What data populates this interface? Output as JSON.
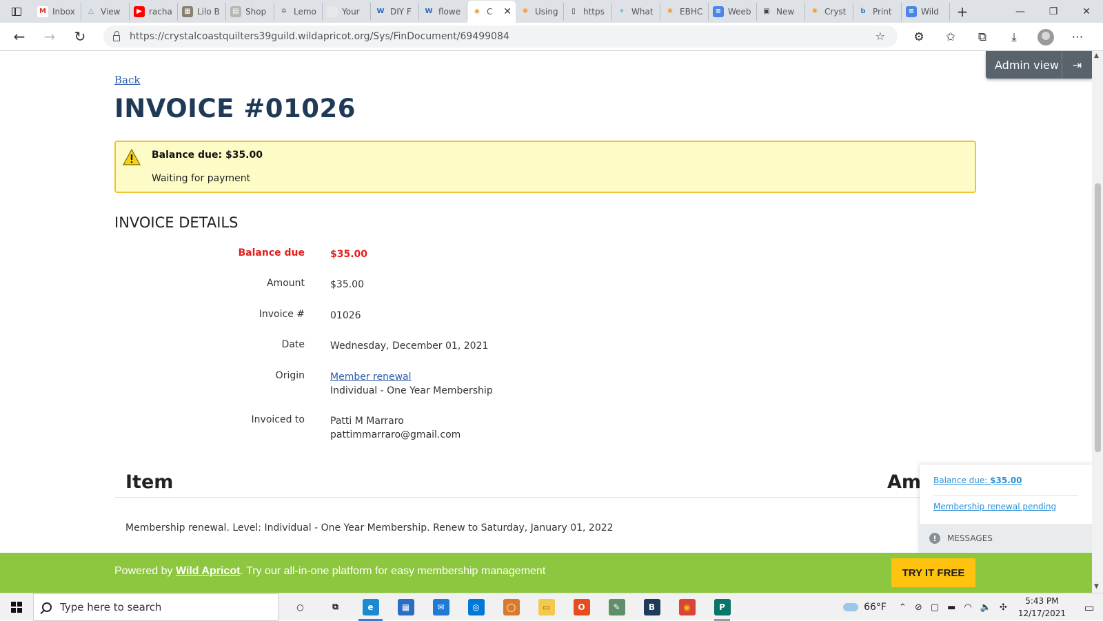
{
  "browser": {
    "tabs": [
      {
        "title": "Inbox",
        "fav_color": "#ffffff",
        "fav_glyph": "M",
        "fav_text_color": "#d93025"
      },
      {
        "title": "View",
        "fav_color": "#dee1e6",
        "fav_glyph": "△",
        "fav_text_color": "#6a8ec4"
      },
      {
        "title": "racha",
        "fav_color": "#ff0000",
        "fav_glyph": "▶",
        "fav_text_color": "#ffffff"
      },
      {
        "title": "Lilo B",
        "fav_color": "#8a7f70",
        "fav_glyph": "▦",
        "fav_text_color": "#ffffff"
      },
      {
        "title": "Shop",
        "fav_color": "#b6b6b6",
        "fav_glyph": "▤",
        "fav_text_color": "#ffffff"
      },
      {
        "title": "Lemo",
        "fav_color": "#dee1e6",
        "fav_glyph": "✲",
        "fav_text_color": "#777777"
      },
      {
        "title": "Your",
        "fav_color": "#e8e8e8",
        "fav_glyph": "",
        "fav_text_color": "#999999"
      },
      {
        "title": "DIY F",
        "fav_color": "#dee1e6",
        "fav_glyph": "W",
        "fav_text_color": "#2a6ab3"
      },
      {
        "title": "flowe",
        "fav_color": "#dee1e6",
        "fav_glyph": "W",
        "fav_text_color": "#2a6ab3"
      },
      {
        "title": "C",
        "fav_color": "#ffffff",
        "fav_glyph": "✺",
        "fav_text_color": "#f29c38",
        "active": true
      },
      {
        "title": "Using",
        "fav_color": "#dee1e6",
        "fav_glyph": "✺",
        "fav_text_color": "#f29c38"
      },
      {
        "title": "https",
        "fav_color": "#dee1e6",
        "fav_glyph": "▯",
        "fav_text_color": "#444444"
      },
      {
        "title": "What",
        "fav_color": "#dee1e6",
        "fav_glyph": "✦",
        "fav_text_color": "#6fb6d6"
      },
      {
        "title": "EBHC",
        "fav_color": "#dee1e6",
        "fav_glyph": "✺",
        "fav_text_color": "#f29c38"
      },
      {
        "title": "Weeb",
        "fav_color": "#4a86e8",
        "fav_glyph": "≡",
        "fav_text_color": "#ffffff"
      },
      {
        "title": "New",
        "fav_color": "#dee1e6",
        "fav_glyph": "▣",
        "fav_text_color": "#444444"
      },
      {
        "title": "Cryst",
        "fav_color": "#dee1e6",
        "fav_glyph": "✺",
        "fav_text_color": "#f29c38"
      },
      {
        "title": "Print",
        "fav_color": "#dee1e6",
        "fav_glyph": "b",
        "fav_text_color": "#2a7bd4"
      },
      {
        "title": "Wild",
        "fav_color": "#4a86e8",
        "fav_glyph": "≡",
        "fav_text_color": "#ffffff"
      }
    ],
    "url": "https://crystalcoastquilters39guild.wildapricot.org/Sys/FinDocument/69499084"
  },
  "invoice": {
    "back_label": "Back",
    "title": "INVOICE #01026",
    "alert_balance": "Balance due: $35.00",
    "alert_status": "Waiting for payment",
    "details_heading": "INVOICE DETAILS",
    "rows": {
      "balance_label": "Balance due",
      "balance_value": "$35.00",
      "amount_label": "Amount",
      "amount_value": "$35.00",
      "number_label": "Invoice #",
      "number_value": "01026",
      "date_label": "Date",
      "date_value": "Wednesday, December 01, 2021",
      "origin_label": "Origin",
      "origin_link": "Member renewal",
      "origin_detail": "Individual - One Year Membership",
      "invoiced_label": "Invoiced to",
      "invoiced_name": "Patti M Marraro",
      "invoiced_email": "pattimmarraro@gmail.com"
    },
    "items_col_item": "Item",
    "items_col_amount": "Am",
    "item_desc": "Membership renewal. Level: Individual - One Year Membership. Renew to Saturday, January 01, 2022"
  },
  "admin": {
    "label": "Admin view",
    "exit_icon": "⇥"
  },
  "messages": {
    "balance_prefix": "Balance due: ",
    "balance_amount": "$35.00",
    "renewal_link": "Membership renewal pending",
    "footer_label": "MESSAGES"
  },
  "powered": {
    "prefix": "Powered by ",
    "brand": "Wild Apricot",
    "suffix": ". Try our all-in-one platform for easy membership management",
    "cta": "TRY IT FREE"
  },
  "taskbar": {
    "search_placeholder": "Type here to search",
    "apps": [
      {
        "name": "cortana",
        "color": "#f1f1f1",
        "glyph": "○",
        "text_color": "#111111"
      },
      {
        "name": "task-view",
        "color": "#f1f1f1",
        "glyph": "⧉",
        "text_color": "#111111"
      },
      {
        "name": "edge",
        "color": "#1b8ad3",
        "glyph": "e",
        "text_color": "#ffffff",
        "state": "active"
      },
      {
        "name": "store",
        "color": "#2b6cc4",
        "glyph": "▦",
        "text_color": "#ffffff"
      },
      {
        "name": "mail",
        "color": "#1f7ad6",
        "glyph": "✉",
        "text_color": "#ffffff"
      },
      {
        "name": "app-blue",
        "color": "#0078d7",
        "glyph": "◎",
        "text_color": "#ffffff"
      },
      {
        "name": "app-orange",
        "color": "#d97a2b",
        "glyph": "◯",
        "text_color": "#ffffff"
      },
      {
        "name": "file-explorer",
        "color": "#f4c84a",
        "glyph": "▭",
        "text_color": "#8a6a1a"
      },
      {
        "name": "office",
        "color": "#e74c1c",
        "glyph": "O",
        "text_color": "#ffffff"
      },
      {
        "name": "app-green",
        "color": "#5f8f6a",
        "glyph": "✎",
        "text_color": "#ffffff"
      },
      {
        "name": "b-app",
        "color": "#1d3c5a",
        "glyph": "B",
        "text_color": "#ffffff"
      },
      {
        "name": "chrome",
        "color": "#db4437",
        "glyph": "◉",
        "text_color": "#f4c20d"
      },
      {
        "name": "publisher",
        "color": "#077568",
        "glyph": "P",
        "text_color": "#ffffff",
        "state": "open"
      }
    ],
    "weather": "66°F",
    "time": "5:43 PM",
    "date": "12/17/2021"
  }
}
